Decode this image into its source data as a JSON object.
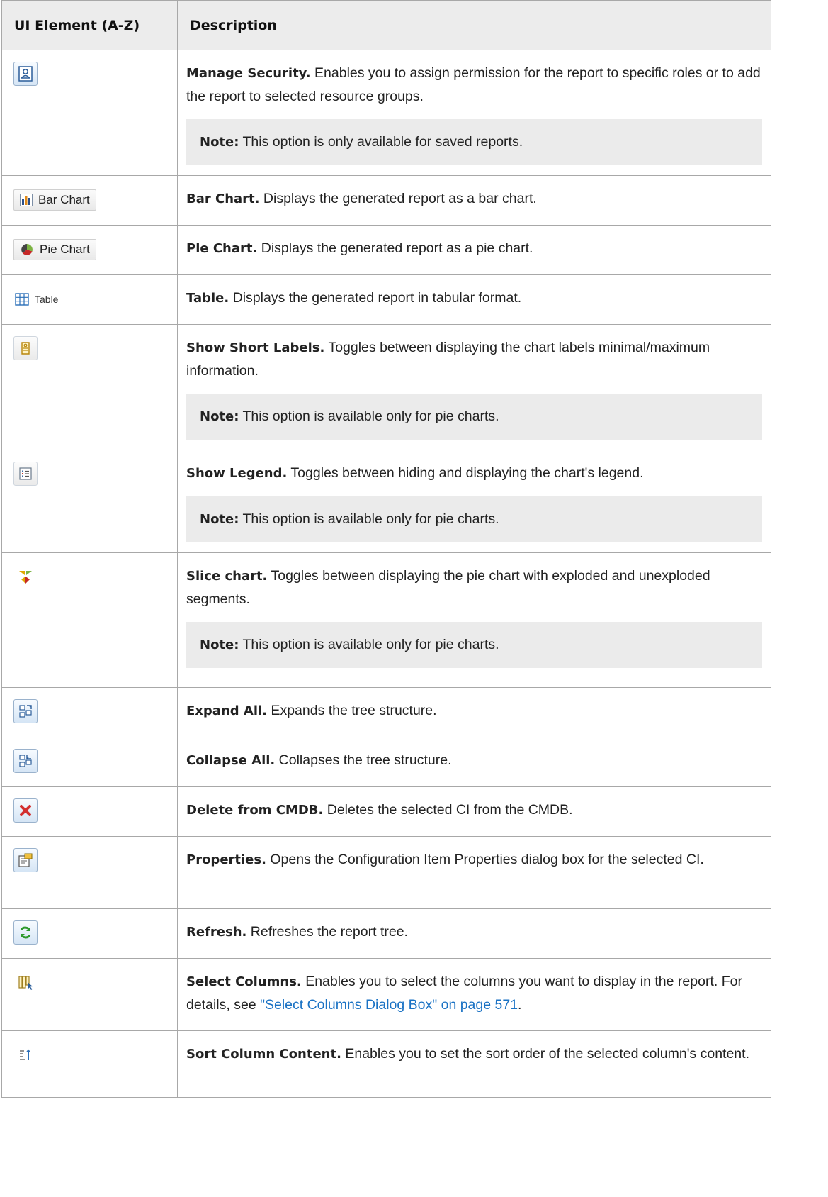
{
  "header": {
    "col1": "UI Element (A-Z)",
    "col2": "Description"
  },
  "rows": [
    {
      "icon": "manage-security-icon",
      "title": "Manage Security.",
      "text": " Enables you to assign permission for the report to specific roles or to add the report to selected resource groups.",
      "note_label": "Note:",
      "note": " This option is only available for saved reports."
    },
    {
      "icon": "bar-chart-icon",
      "button_label": "Bar Chart",
      "title": "Bar Chart.",
      "text": " Displays the generated report as a bar chart."
    },
    {
      "icon": "pie-chart-icon",
      "button_label": "Pie Chart",
      "title": "Pie Chart.",
      "text": " Displays the generated report as a pie chart."
    },
    {
      "icon": "table-icon",
      "button_label": "Table",
      "title": "Table.",
      "text": " Displays the generated report in tabular format."
    },
    {
      "icon": "short-labels-icon",
      "title": "Show Short Labels.",
      "text": " Toggles between displaying the chart labels minimal/maximum information.",
      "note_label": "Note:",
      "note": " This option is available only for pie charts."
    },
    {
      "icon": "legend-icon",
      "title": "Show Legend.",
      "text": " Toggles between hiding and displaying the chart's legend.",
      "note_label": "Note:",
      "note": " This option is available only for pie charts."
    },
    {
      "icon": "slice-chart-icon",
      "title": "Slice chart.",
      "text": " Toggles between displaying the pie chart with exploded and unexploded segments.",
      "note_label": "Note:",
      "note": " This option is available only for pie charts."
    },
    {
      "icon": "expand-all-icon",
      "title": "Expand All.",
      "text": " Expands the tree structure."
    },
    {
      "icon": "collapse-all-icon",
      "title": "Collapse All.",
      "text": " Collapses the tree structure."
    },
    {
      "icon": "delete-icon",
      "title": "Delete from CMDB.",
      "text": " Deletes the selected CI from the CMDB."
    },
    {
      "icon": "properties-icon",
      "title": "Properties.",
      "text": " Opens the Configuration Item Properties dialog box for the selected CI."
    },
    {
      "icon": "refresh-icon",
      "title": "Refresh.",
      "text": " Refreshes the report tree."
    },
    {
      "icon": "select-columns-icon",
      "title": "Select Columns.",
      "text": " Enables you to select the columns you want to display in the report. For details, see ",
      "link": "\"Select Columns Dialog Box\" on page 571",
      "text_after": "."
    },
    {
      "icon": "sort-column-icon",
      "title": "Sort Column Content.",
      "text": " Enables you to set the sort order of the selected column's content."
    }
  ]
}
